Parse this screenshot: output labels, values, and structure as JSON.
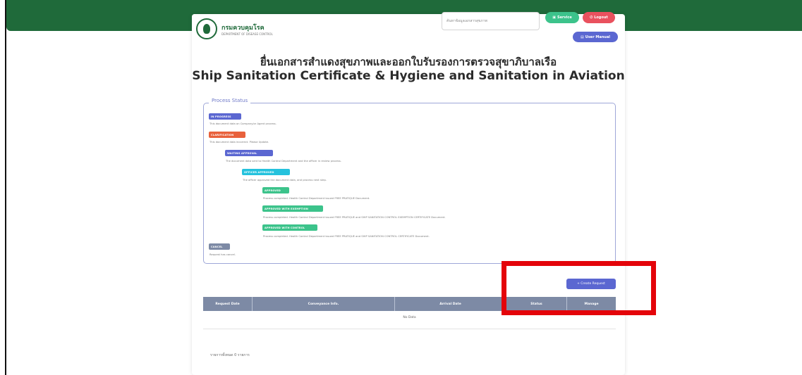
{
  "header": {
    "logo_name": "กรมควบคุมโรค",
    "logo_sub": "DEPARTMENT OF DISEASE CONTROL",
    "search_placeholder": "ค้นหาข้อมูลเอกสารสุขภาพ",
    "service_label": "Service",
    "logout_label": "Logout",
    "manual_label": "User Manual"
  },
  "page": {
    "title_th": "ยื่นเอกสารสำแดงสุขภาพและออกใบรับรองการตรวจสุขาภิบาลเรือ",
    "title_en": "Ship Sanitation Certificate & Hygiene and Sanitation in Aviation"
  },
  "process": {
    "legend": "Process Status",
    "items": [
      {
        "badge": "IN PROGRESS",
        "color": "#5b67d1",
        "desc": "This document data on Company/or Agent process."
      },
      {
        "badge": "CLARIFICATION",
        "color": "#e8613c",
        "desc": "This document data incorrect. Please Update."
      },
      {
        "badge": "WAITING APPROVAL",
        "color": "#5b67d1",
        "desc": "The document data sent to Health Control Department and the officer in review process."
      },
      {
        "badge": "OFFICER APPROVED",
        "color": "#25c2dd",
        "desc": "The officer approved the document data, and process next step."
      },
      {
        "badge": "APPROVED",
        "color": "#3cc38b",
        "desc": "Process completed. Health Control Department issued FREE PRATIQUE Document."
      },
      {
        "badge": "APPROVED WITH EXEMPTION",
        "color": "#3cc38b",
        "desc": "Process completed. Health Control Department issued FREE PRATIQUE and SHIP SANITATION CONTROL EXEMPTION CERTIFICATE Document."
      },
      {
        "badge": "APPROVED WITH CONTROL",
        "color": "#3cc38b",
        "desc": "Process completed. Health Control Department issued FREE PRATIQUE and SHIP SANITATION CONTROL CERTIFICATE Document."
      },
      {
        "badge": "CANCEL",
        "color": "#7d8aa5",
        "desc": "Request has cancel."
      }
    ]
  },
  "actions": {
    "create_request": "+ Create Request"
  },
  "table": {
    "columns": [
      "Request Date",
      "Conveyance Info.",
      "Arrival Date",
      "Status",
      "Manage"
    ],
    "empty_text": "No Data",
    "footer_count": "รายการทั้งหมด 0 รายการ"
  }
}
